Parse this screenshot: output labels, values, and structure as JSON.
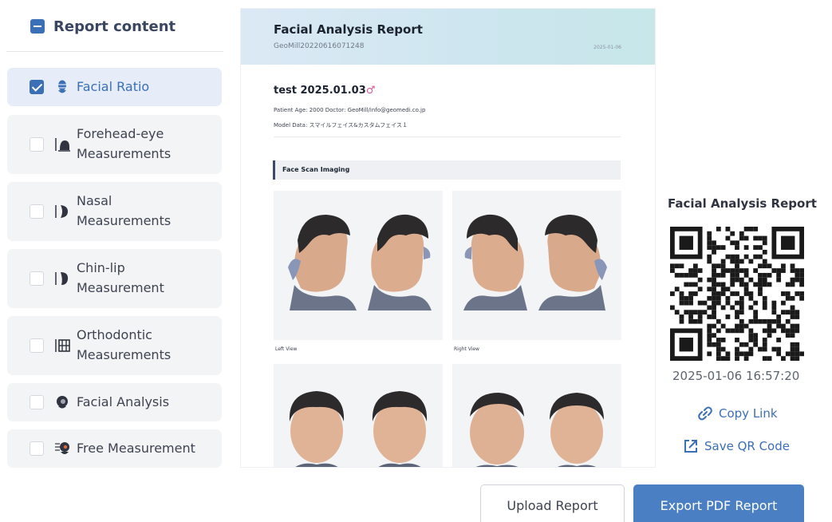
{
  "sidebar": {
    "title": "Report content",
    "items": [
      {
        "label": "Facial Ratio",
        "checked": true,
        "active": true,
        "icon": "face-ratio-icon"
      },
      {
        "label_lines": [
          "Forehead-eye",
          "Measurements"
        ],
        "checked": false,
        "icon": "forehead-eye-icon"
      },
      {
        "label_lines": [
          "Nasal",
          "Measurements"
        ],
        "checked": false,
        "icon": "nasal-icon"
      },
      {
        "label_lines": [
          "Chin-lip",
          "Measurement"
        ],
        "checked": false,
        "icon": "chin-lip-icon"
      },
      {
        "label_lines": [
          "Orthodontic",
          "Measurements"
        ],
        "checked": false,
        "icon": "orthodontic-icon"
      },
      {
        "label": "Facial Analysis",
        "checked": false,
        "icon": "facial-analysis-icon"
      },
      {
        "label": "Free Measurement",
        "checked": false,
        "icon": "free-measurement-icon"
      }
    ]
  },
  "report": {
    "title": "Facial Analysis Report",
    "id": "GeoMill20220616071248",
    "date": "2025-01-06",
    "patient_name": "test 2025.01.03",
    "sex_symbol": "♂",
    "meta_line_1": "Patient Age: 2000 Doctor: GeoMill/info@geomedi.co.jp",
    "meta_line_2": "Model Data: スマイルフェイス&カスタムフェイス１",
    "section_title": "Face Scan Imaging",
    "photos": [
      {
        "caption": "Left View",
        "icon": "face-scan-left-image"
      },
      {
        "caption": "Right View",
        "icon": "face-scan-right-image"
      },
      {
        "caption": "",
        "icon": "face-scan-front-image"
      },
      {
        "caption": "",
        "icon": "face-scan-bottom-image"
      }
    ]
  },
  "share": {
    "title": "Facial Analysis Report",
    "qr_icon": "qr-code-icon",
    "timestamp": "2025-01-06 16:57:20",
    "copy_link_label": "Copy Link",
    "save_qr_label": "Save QR Code"
  },
  "footer": {
    "upload_label": "Upload Report",
    "export_label": "Export PDF Report"
  },
  "colors": {
    "accent": "#3b6fb6",
    "export_button": "#4a7fc3",
    "active_item": "#e6edf8",
    "header_gradient_start": "#dbe9f5",
    "header_gradient_end": "#c7e7e9"
  }
}
